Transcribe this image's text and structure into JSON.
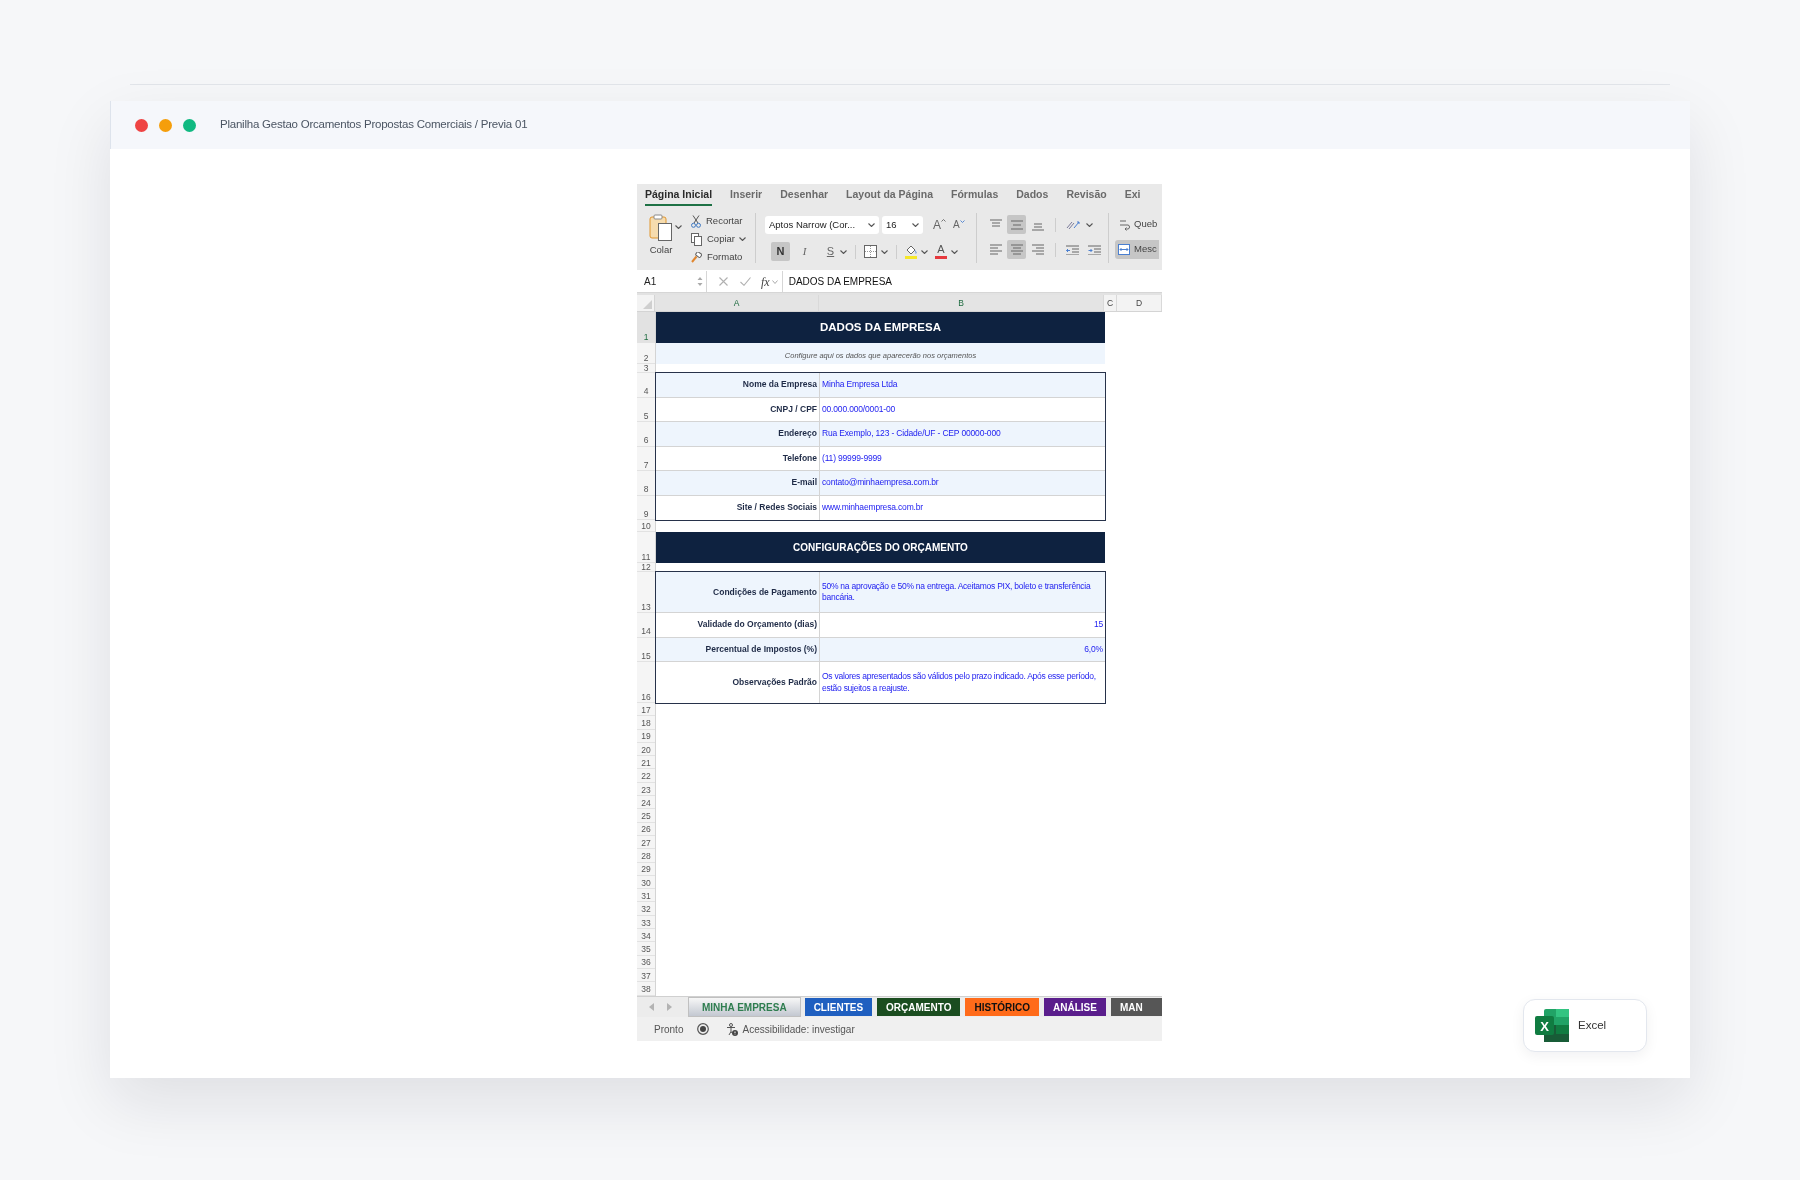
{
  "window": {
    "title": "Planilha Gestao Orcamentos Propostas Comerciais / Previa 01"
  },
  "excel": {
    "ribbon_tabs": [
      {
        "label": "Página Inicial",
        "selected": true
      },
      {
        "label": "Inserir",
        "selected": false
      },
      {
        "label": "Desenhar",
        "selected": false
      },
      {
        "label": "Layout da Página",
        "selected": false
      },
      {
        "label": "Fórmulas",
        "selected": false
      },
      {
        "label": "Dados",
        "selected": false
      },
      {
        "label": "Revisão",
        "selected": false
      },
      {
        "label": "Exi",
        "selected": false
      }
    ],
    "clipboard": {
      "paste": "Colar",
      "cut": "Recortar",
      "copy": "Copiar",
      "format_painter": "Formato"
    },
    "font": {
      "name": "Aptos Narrow (Cor...",
      "size": "16",
      "grow": "A",
      "shrink": "A",
      "color_letter": "A"
    },
    "style_toggles": [
      {
        "label": "N",
        "kind": "bold",
        "on": true
      },
      {
        "label": "I",
        "kind": "italic",
        "on": false
      },
      {
        "label": "S",
        "kind": "underline",
        "on": false
      }
    ],
    "vertical_align": [
      {
        "kind": "top",
        "selected": false
      },
      {
        "kind": "middle",
        "selected": true
      },
      {
        "kind": "bottom",
        "selected": false
      }
    ],
    "horizontal_align": [
      {
        "kind": "left",
        "selected": false
      },
      {
        "kind": "center",
        "selected": true
      },
      {
        "kind": "right",
        "selected": false
      }
    ],
    "wrap_text": {
      "label": "Queb"
    },
    "merge": {
      "label": "Mesc",
      "on": true
    },
    "formula_bar": {
      "cell": "A1",
      "function_symbol": "fx",
      "formula": "DADOS DA EMPRESA"
    },
    "columns": [
      {
        "label": "A",
        "selected": true
      },
      {
        "label": "B",
        "selected": true
      },
      {
        "label": "C",
        "selected": false
      },
      {
        "label": "D",
        "selected": false
      }
    ],
    "row_headers": [
      {
        "label": "1",
        "selected": true
      },
      {
        "label": "2",
        "selected": false
      },
      {
        "label": "3",
        "selected": false
      },
      {
        "label": "4",
        "selected": false
      },
      {
        "label": "5",
        "selected": false
      },
      {
        "label": "6",
        "selected": false
      },
      {
        "label": "7",
        "selected": false
      },
      {
        "label": "8",
        "selected": false
      },
      {
        "label": "9",
        "selected": false
      },
      {
        "label": "10",
        "selected": false
      },
      {
        "label": "11",
        "selected": false
      },
      {
        "label": "12",
        "selected": false
      },
      {
        "label": "13",
        "selected": false
      },
      {
        "label": "14",
        "selected": false
      },
      {
        "label": "15",
        "selected": false
      },
      {
        "label": "16",
        "selected": false
      },
      {
        "label": "17",
        "selected": false
      },
      {
        "label": "18",
        "selected": false
      },
      {
        "label": "19",
        "selected": false
      },
      {
        "label": "20",
        "selected": false
      },
      {
        "label": "21",
        "selected": false
      },
      {
        "label": "22",
        "selected": false
      },
      {
        "label": "23",
        "selected": false
      },
      {
        "label": "24",
        "selected": false
      },
      {
        "label": "25",
        "selected": false
      },
      {
        "label": "26",
        "selected": false
      },
      {
        "label": "27",
        "selected": false
      },
      {
        "label": "28",
        "selected": false
      },
      {
        "label": "29",
        "selected": false
      },
      {
        "label": "30",
        "selected": false
      },
      {
        "label": "31",
        "selected": false
      },
      {
        "label": "32",
        "selected": false
      },
      {
        "label": "33",
        "selected": false
      },
      {
        "label": "34",
        "selected": false
      },
      {
        "label": "35",
        "selected": false
      },
      {
        "label": "36",
        "selected": false
      },
      {
        "label": "37",
        "selected": false
      },
      {
        "label": "38",
        "selected": false
      }
    ],
    "sections": [
      {
        "title": "DADOS DA EMPRESA",
        "subtitle": "Configure aqui os dados que aparecerão nos orçamentos",
        "fields": [
          {
            "label": "Nome da Empresa",
            "value": "Minha Empresa Ltda",
            "kind": "text"
          },
          {
            "label": "CNPJ / CPF",
            "value": "00.000.000/0001-00",
            "kind": "text"
          },
          {
            "label": "Endereço",
            "value": "Rua Exemplo, 123 - Cidade/UF - CEP 00000-000",
            "kind": "text"
          },
          {
            "label": "Telefone",
            "value": "(11) 99999-9999",
            "kind": "text"
          },
          {
            "label": "E-mail",
            "value": "contato@minhaempresa.com.br",
            "kind": "text"
          },
          {
            "label": "Site / Redes Sociais",
            "value": "www.minhaempresa.com.br",
            "kind": "text"
          }
        ]
      },
      {
        "title": "CONFIGURAÇÕES DO ORÇAMENTO",
        "fields": [
          {
            "label": "Condições de Pagamento",
            "value": "50% na aprovação e 50% na entrega. Aceitamos PIX, boleto e transferência bancária.",
            "kind": "paragraph"
          },
          {
            "label": "Validade do Orçamento (dias)",
            "value": "15",
            "kind": "number"
          },
          {
            "label": "Percentual de Impostos (%)",
            "value": "6,0%",
            "kind": "number"
          },
          {
            "label": "Observações Padrão",
            "value": "Os valores apresentados são válidos pelo prazo indicado. Após esse período, estão sujeitos a reajuste.",
            "kind": "paragraph"
          }
        ]
      }
    ],
    "sheet_tabs": [
      {
        "label": "MINHA EMPRESA",
        "selected": true,
        "color": "#2e7d4f"
      },
      {
        "label": "CLIENTES",
        "selected": false,
        "color": "#1f5fc0"
      },
      {
        "label": "ORÇAMENTO",
        "selected": false,
        "color": "#1b4d20"
      },
      {
        "label": "HISTÓRICO",
        "selected": false,
        "color": "#ff6b1a"
      },
      {
        "label": "ANÁLISE",
        "selected": false,
        "color": "#5a1e8c"
      },
      {
        "label": "MAN",
        "selected": false,
        "color": "#565656"
      }
    ],
    "status_bar": {
      "status": "Pronto",
      "accessibility": "Acessibilidade: investigar"
    }
  },
  "app_badge": {
    "label": "Excel",
    "logo_letter": "X"
  }
}
